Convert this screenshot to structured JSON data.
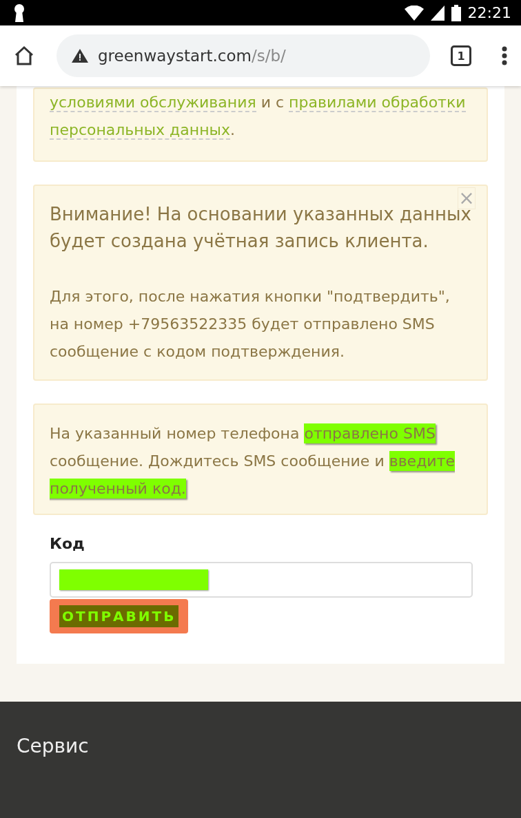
{
  "status_bar": {
    "time": "22:21"
  },
  "browser": {
    "url_host": "greenwaystart.com",
    "url_path": "/s/b/",
    "tab_count": "1"
  },
  "consent_card": {
    "parts": [
      {
        "text": "условиями обслуживания",
        "link": true
      },
      {
        "text": " и с ",
        "link": false
      },
      {
        "text": "правилами обработки персональных данных",
        "link": true
      },
      {
        "text": ".",
        "link": false
      }
    ]
  },
  "notice_card": {
    "close": "×",
    "title": "Внимание! На основании указанных данных будет создана учётная запись клиента.",
    "body": "Для этого, после нажатия кнопки \"подтвердить\", на номер +79563522335 будет отправлено SMS сообщение с кодом подтверждения."
  },
  "sms_card": {
    "parts": [
      {
        "text": "На указанный номер телефона ",
        "highlighted": false
      },
      {
        "text": "отправлено SMS ",
        "highlighted": true
      },
      {
        "text": "сообщение. Дождитесь SMS сообщение и ",
        "highlighted": false
      },
      {
        "text": "введите полученный код.",
        "highlighted": true
      }
    ]
  },
  "code_field": {
    "label": "Код",
    "masked": true
  },
  "submit_button": {
    "label": "ОТПРАВИТЬ",
    "highlighted": true
  },
  "footer": {
    "heading": "Сервис"
  }
}
